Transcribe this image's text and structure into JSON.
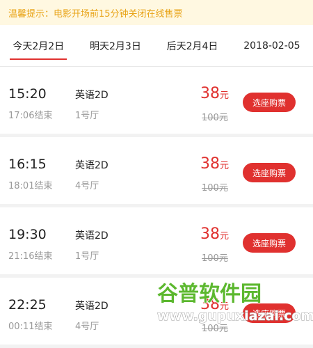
{
  "notice": "温馨提示：电影开场前15分钟关闭在线售票",
  "tabs": [
    {
      "label": "今天2月2日",
      "active": true
    },
    {
      "label": "明天2月3日",
      "active": false
    },
    {
      "label": "后天2月4日",
      "active": false
    },
    {
      "label": "2018-02-05",
      "active": false
    }
  ],
  "sessions": [
    {
      "start": "15:20",
      "end": "17:06结束",
      "language": "英语2D",
      "hall": "1号厅",
      "price": "38",
      "unit": "元",
      "original": "100元",
      "button": "选座购票"
    },
    {
      "start": "16:15",
      "end": "18:01结束",
      "language": "英语2D",
      "hall": "4号厅",
      "price": "38",
      "unit": "元",
      "original": "100元",
      "button": "选座购票"
    },
    {
      "start": "19:30",
      "end": "21:16结束",
      "language": "英语2D",
      "hall": "1号厅",
      "price": "38",
      "unit": "元",
      "original": "100元",
      "button": "选座购票"
    },
    {
      "start": "22:25",
      "end": "00:11结束",
      "language": "英语2D",
      "hall": "4号厅",
      "price": "38",
      "unit": "元",
      "original": "100元",
      "button": "选座购票"
    }
  ],
  "watermark": {
    "brand": "谷普软件园",
    "url": "www.gupuxiazai.com"
  },
  "colors": {
    "accent": "#e0312f",
    "notice_text": "#e8a317",
    "notice_bg": "#fff8e1"
  }
}
